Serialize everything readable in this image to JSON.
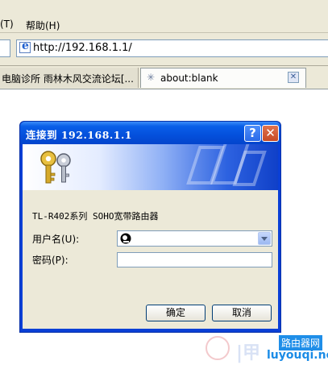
{
  "browser": {
    "menu": [
      {
        "label": "(T)",
        "underline_key": "T"
      },
      {
        "label": "帮助(H)",
        "underline_key": "H"
      }
    ],
    "address_url": "http://192.168.1.1/",
    "tabs": [
      {
        "label": "电脑诊所 雨林木风交流论坛[...",
        "active": false
      },
      {
        "label": "about:blank",
        "active": true,
        "icon": "loading-icon"
      }
    ],
    "tab_close_glyph": "✕"
  },
  "dialog": {
    "title": "连接到 192.168.1.1",
    "help_glyph": "?",
    "close_glyph": "✕",
    "router_name": "TL-R402系列 SOHO宽带路由器",
    "username_label": "用户名(U):",
    "password_label": "密码(P):",
    "username_value": "",
    "password_value": "",
    "ok_label": "确定",
    "cancel_label": "取消",
    "banner_icon": "keys-icon"
  },
  "watermark": {
    "cn": "路由器网",
    "en": "luyouqi.net"
  },
  "colors": {
    "titlebar": "#0450dc",
    "dialog_face": "#ece9d8",
    "chrome": "#ece9d8",
    "watermark_blue": "#1a8be6"
  }
}
